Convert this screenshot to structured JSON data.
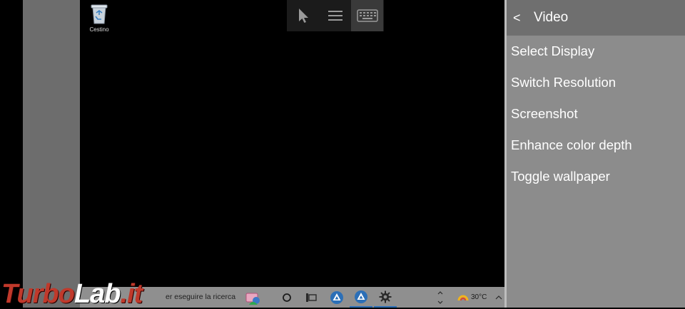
{
  "desktop": {
    "recycle_bin_label": "Cestino"
  },
  "toolbar": {
    "buttons": [
      {
        "icon": "mouse-pointer-icon"
      },
      {
        "icon": "hamburger-menu-icon"
      },
      {
        "icon": "keyboard-icon",
        "active": true
      }
    ]
  },
  "taskbar": {
    "search_placeholder": "er eseguire la ricerca",
    "weather_temp": "30°C"
  },
  "watermark": {
    "part1": "Turbo",
    "part2": "Lab",
    "part3": ".it"
  },
  "panel": {
    "back_symbol": "<",
    "title": "Video",
    "items": [
      {
        "label": "Select Display"
      },
      {
        "label": "Switch Resolution"
      },
      {
        "label": "Screenshot"
      },
      {
        "label": "Enhance color depth"
      },
      {
        "label": "Toggle wallpaper"
      }
    ]
  },
  "colors": {
    "panel_bg": "#8c8c8c",
    "panel_header_bg": "#6f6f6f",
    "taskbar_bg": "#8f8f8f",
    "watermark_red": "#c0392b"
  }
}
